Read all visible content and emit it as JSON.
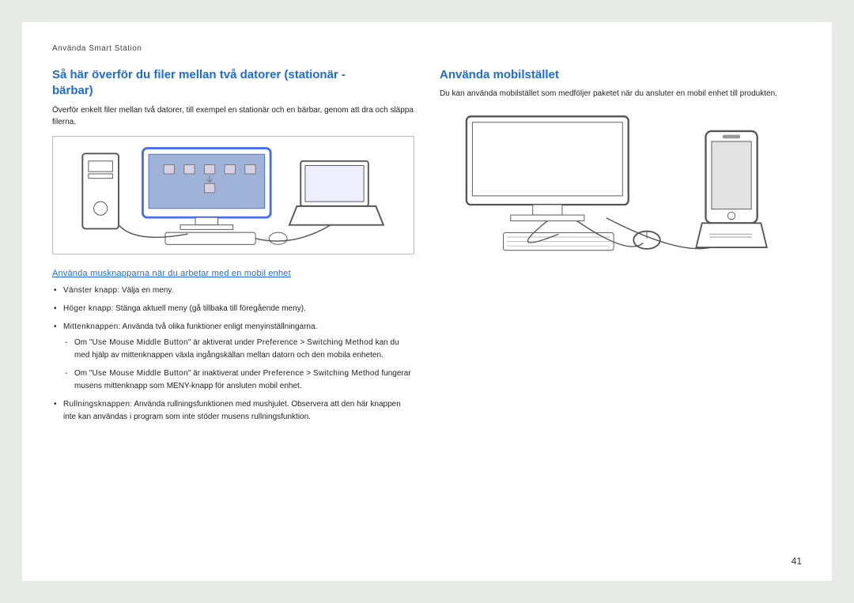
{
  "header": "Använda Smart Station",
  "left": {
    "title_line1": "Så här överför du filer mellan två datorer (stationär -",
    "title_line2": "bärbar)",
    "intro": "Överför enkelt filer mellan två datorer, till exempel en stationär och en bärbar, genom att dra och släppa filerna.",
    "subhead": "Använda musknapparna när du arbetar med en mobil enhet",
    "bullets": {
      "b1_term": "Vänster knapp",
      "b1_text": ": Välja en meny.",
      "b2_term": "Höger knapp",
      "b2_text": ": Stänga aktuell meny (gå tillbaka till föregående meny).",
      "b3_term": "Mittenknappen",
      "b3_text": ": Använda två olika funktioner enligt menyinställningarna.",
      "b3_d1_pre": "Om \"",
      "b3_d1_q": "Use Mouse Middle Button",
      "b3_d1_mid": "\" är aktiverat under ",
      "b3_d1_pref": "Preference",
      "b3_d1_gt": " > ",
      "b3_d1_sw": "Switching Method",
      "b3_d1_rest": " kan du med hjälp av mittenknappen växla ingångskällan mellan datorn och den mobila enheten.",
      "b3_d2_pre": "Om \"",
      "b3_d2_q": "Use Mouse Middle Button",
      "b3_d2_mid": "\" är inaktiverat under ",
      "b3_d2_pref": "Preference",
      "b3_d2_gt": " > ",
      "b3_d2_sw": "Switching Method",
      "b3_d2_rest": " fungerar musens mittenknapp som MENY-knapp för ansluten mobil enhet.",
      "b4_term": "Rullningsknappen",
      "b4_text": ": Använda rullningsfunktionen med mushjulet. Observera att den här knappen inte kan användas i program som inte stöder musens rullningsfunktion."
    }
  },
  "right": {
    "title": "Använda mobilstället",
    "intro": "Du kan använda mobilstället som medföljer paketet när du ansluter en mobil enhet till produkten."
  },
  "pagenum": "41"
}
